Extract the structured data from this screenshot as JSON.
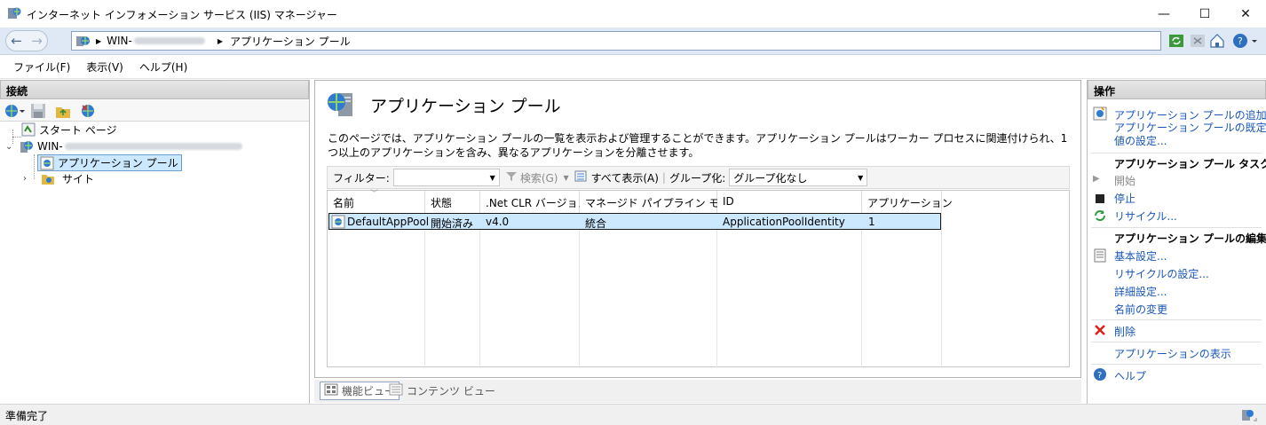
{
  "window": {
    "title": "インターネット インフォメーション サービス (IIS) マネージャー",
    "minimize": "—",
    "maximize": "☐",
    "close": "✕"
  },
  "address": {
    "back": "←",
    "forward": "→",
    "server": "WIN-",
    "location": "アプリケーション プール"
  },
  "menu": [
    "ファイル(F)",
    "表示(V)",
    "ヘルプ(H)"
  ],
  "connections": {
    "header": "接続",
    "tree": {
      "start_page": "スタート ページ",
      "server": "WIN-",
      "app_pools": "アプリケーション プール",
      "sites": "サイト"
    }
  },
  "main": {
    "heading": "アプリケーション プール",
    "description": "このページでは、アプリケーション プールの一覧を表示および管理することができます。アプリケーション プールはワーカー プロセスに関連付けられ、1 つ以上のアプリケーションを含み、異なるアプリケーションを分離させます。",
    "filter": {
      "label": "フィルター:",
      "value": "",
      "search": "検索(G)",
      "show_all": "すべて表示(A)",
      "group_label": "グループ化:",
      "group_value": "グループ化なし"
    },
    "columns": [
      "名前",
      "状態",
      ".Net CLR バージョン",
      "マネージド パイプライン モード",
      "ID",
      "アプリケーション"
    ],
    "rows": [
      {
        "name": "DefaultAppPool",
        "status": "開始済み",
        "clr": "v4.0",
        "pipeline": "統合",
        "identity": "ApplicationPoolIdentity",
        "apps": "1"
      }
    ],
    "view_tabs": {
      "features": "機能ビュー",
      "content": "コンテンツ ビュー"
    }
  },
  "actions": {
    "header": "操作",
    "add": "アプリケーション プールの追加...",
    "defaults": "アプリケーション プールの既定値の設定...",
    "tasks_header": "アプリケーション プール タスク",
    "start": "開始",
    "stop": "停止",
    "recycle": "リサイクル...",
    "edit_header": "アプリケーション プールの編集",
    "basic": "基本設定...",
    "recycle_settings": "リサイクルの設定...",
    "advanced": "詳細設定...",
    "rename": "名前の変更",
    "delete": "削除",
    "view_apps": "アプリケーションの表示",
    "help": "ヘルプ"
  },
  "status": {
    "text": "準備完了"
  },
  "colors": {
    "link": "#1a56b8",
    "selection": "#cce8ff",
    "delete": "#d7261e"
  }
}
